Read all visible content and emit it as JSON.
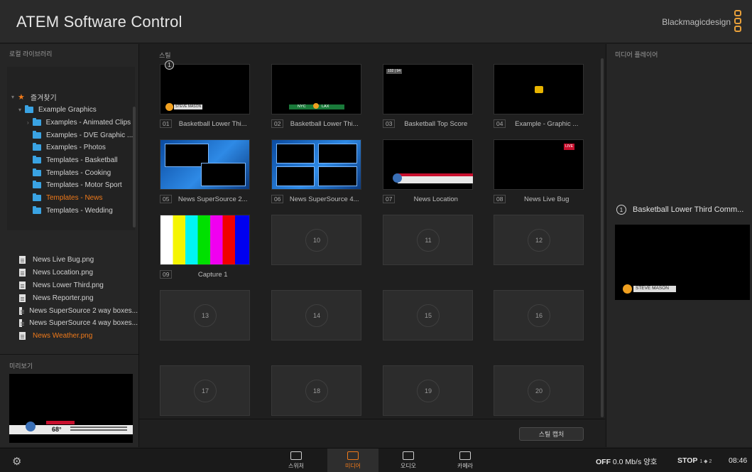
{
  "app": {
    "title": "ATEM Software Control",
    "brand": "Blackmagicdesign"
  },
  "left": {
    "library_label": "로컬 라이브러리",
    "tree": [
      {
        "label": "즐겨찾기",
        "type": "favorite"
      },
      {
        "label": "Example Graphics",
        "type": "folder"
      },
      {
        "label": "Examples - Animated Clips",
        "type": "folder"
      },
      {
        "label": "Examples - DVE Graphic ...",
        "type": "folder"
      },
      {
        "label": "Examples - Photos",
        "type": "folder"
      },
      {
        "label": "Templates - Basketball",
        "type": "folder"
      },
      {
        "label": "Templates - Cooking",
        "type": "folder"
      },
      {
        "label": "Templates - Motor Sport",
        "type": "folder"
      },
      {
        "label": "Templates - News",
        "type": "folder",
        "active": true
      },
      {
        "label": "Templates - Wedding",
        "type": "folder"
      }
    ],
    "files": [
      "News Live Bug.png",
      "News Location.png",
      "News Lower Third.png",
      "News Reporter.png",
      "News SuperSource 2 way boxes...",
      "News SuperSource 4 way boxes...",
      "News Weather.png"
    ],
    "active_file_index": 6,
    "preview_label": "미리보기",
    "preview_temp": "68°"
  },
  "middle": {
    "stills_label": "스틸",
    "slots": [
      {
        "num": "01",
        "label": "Basketball Lower Thi..."
      },
      {
        "num": "02",
        "label": "Basketball Lower Thi..."
      },
      {
        "num": "03",
        "label": "Basketball Top Score"
      },
      {
        "num": "04",
        "label": "Example - Graphic ..."
      },
      {
        "num": "05",
        "label": "News SuperSource 2..."
      },
      {
        "num": "06",
        "label": "News SuperSource 4..."
      },
      {
        "num": "07",
        "label": "News Location"
      },
      {
        "num": "08",
        "label": "News Live Bug"
      },
      {
        "num": "09",
        "label": "Capture 1"
      }
    ],
    "empty_slots": [
      "10",
      "11",
      "12",
      "13",
      "14",
      "15",
      "16",
      "17",
      "18",
      "19",
      "20"
    ],
    "badge": "1",
    "thumb_texts": {
      "steve": "STEVE MASON",
      "nyc": "NYC",
      "lax": "LAX",
      "live": "LIVE",
      "score": "102 | 94"
    },
    "capture_button": "스틸 캡처"
  },
  "right": {
    "label": "미디어 플레이어",
    "player_num": "1",
    "player_title": "Basketball Lower Third Comm...",
    "player_caption": "STEVE MASON"
  },
  "bottombar": {
    "tabs": [
      {
        "label": "스위처"
      },
      {
        "label": "미디어",
        "active": true
      },
      {
        "label": "오디오"
      },
      {
        "label": "카메라"
      }
    ],
    "status_off": "OFF",
    "status_rate": "0.0 Mb/s 양호",
    "status_stop": "STOP",
    "status_pages": "1 ◆ 2",
    "clock": "08:46"
  },
  "colors": {
    "accent": "#f07a1a",
    "folder": "#3aa3e3"
  }
}
